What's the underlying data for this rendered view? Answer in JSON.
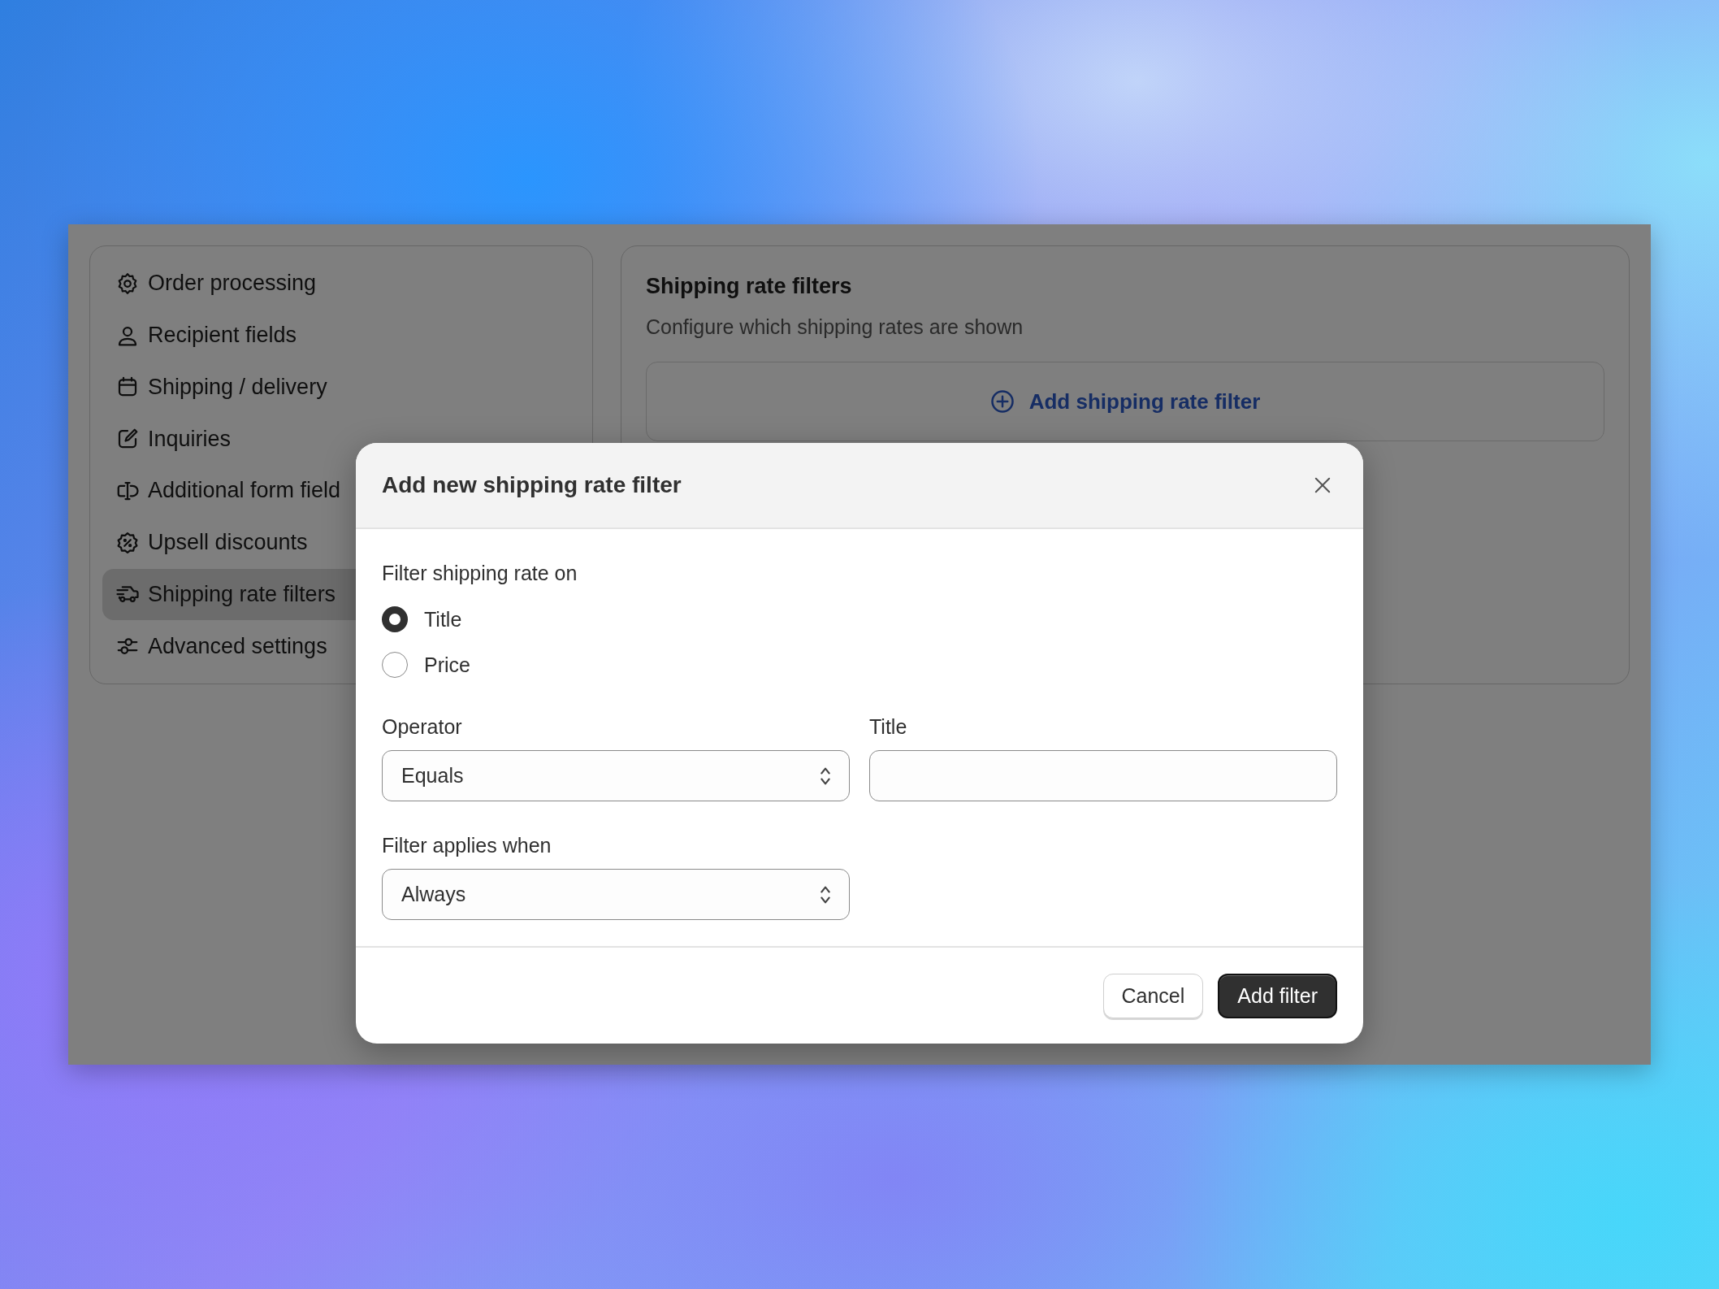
{
  "sidebar": {
    "items": [
      {
        "label": "Order processing",
        "selected": false
      },
      {
        "label": "Recipient fields",
        "selected": false
      },
      {
        "label": "Shipping / delivery",
        "selected": false
      },
      {
        "label": "Inquiries",
        "selected": false
      },
      {
        "label": "Additional form field",
        "selected": false
      },
      {
        "label": "Upsell discounts",
        "selected": false
      },
      {
        "label": "Shipping rate filters",
        "selected": true
      },
      {
        "label": "Advanced settings",
        "selected": false
      }
    ]
  },
  "main": {
    "title": "Shipping rate filters",
    "subtitle": "Configure which shipping rates are shown",
    "add_button": "Add shipping rate filter"
  },
  "dialog": {
    "title": "Add new shipping rate filter",
    "filter_on": {
      "label": "Filter shipping rate on",
      "options": [
        {
          "label": "Title",
          "selected": true
        },
        {
          "label": "Price",
          "selected": false
        }
      ]
    },
    "operator": {
      "label": "Operator",
      "value": "Equals"
    },
    "title_field": {
      "label": "Title"
    },
    "applies_when": {
      "label": "Filter applies when",
      "value": "Always"
    },
    "buttons": [
      {
        "label": "Cancel",
        "kind": "secondary"
      },
      {
        "label": "Add filter",
        "kind": "primary"
      }
    ]
  }
}
